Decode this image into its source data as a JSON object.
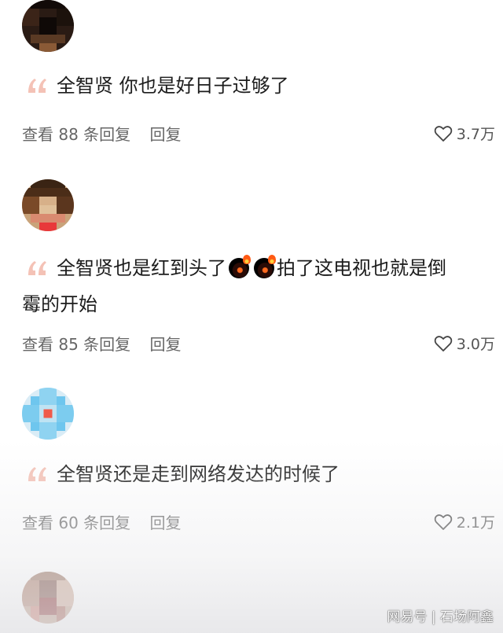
{
  "comments": [
    {
      "text": "全智贤 你也是好日子过够了",
      "replies": "查看 88 条回复",
      "reply": "回复",
      "likes": "3.7万"
    },
    {
      "text_a": "全智贤也是红到头了",
      "text_b": "拍了这电视也就是倒",
      "text_line2": "霉的开始",
      "emoji": [
        "fire-emoji",
        "fire-emoji"
      ],
      "replies": "查看 85 条回复",
      "reply": "回复",
      "likes": "3.0万"
    },
    {
      "text": "全智贤还是走到网络发达的时候了",
      "replies": "查看 60 条回复",
      "reply": "回复",
      "likes": "2.1万"
    }
  ],
  "watermark": "网易号 | 石场阿鑫",
  "colors": {
    "text": "#1c1c1c",
    "meta": "#666666",
    "quote_mark": "#f4c2b6"
  }
}
